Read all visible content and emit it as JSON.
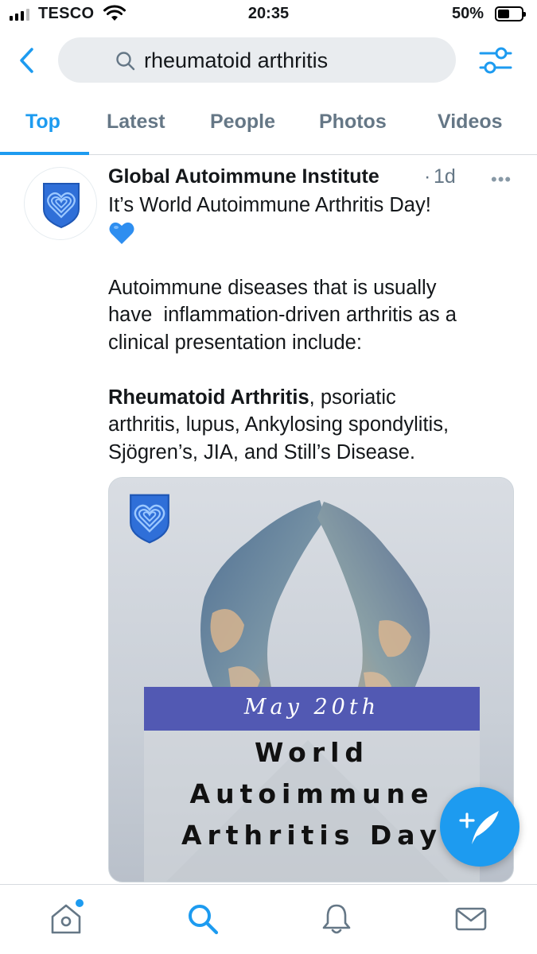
{
  "status_bar": {
    "carrier": "TESCO",
    "time": "20:35",
    "battery_percent": "50%",
    "battery_level": 0.5,
    "signal_bars": 3,
    "signal_bars_total": 4
  },
  "header": {
    "back_icon": "chevron-left-icon",
    "search_query": "rheumatoid arthritis",
    "search_icon": "search-icon",
    "filter_icon": "sliders-icon"
  },
  "tabs": [
    {
      "label": "Top",
      "active": true
    },
    {
      "label": "Latest",
      "active": false
    },
    {
      "label": "People",
      "active": false
    },
    {
      "label": "Photos",
      "active": false
    },
    {
      "label": "Videos",
      "active": false
    }
  ],
  "tweet": {
    "author": "Global Autoimmune Institute",
    "separator": "·",
    "age": "1d",
    "more_icon": "more-horizontal-icon",
    "line1": "It’s World Autoimmune Arthritis Day!",
    "emoji": "blue-heart-emoji",
    "para2": [
      "Autoimmune diseases that is usually",
      "have  inflammation-driven arthritis as a",
      "clinical presentation include:"
    ],
    "para3_bold": "Rheumatoid Arthritis",
    "para3_line1_rest": ", psoriatic",
    "para3_line2": "arthritis, lupus, Ankylosing spondylitis,",
    "para3_line3": "Sjögren’s, JIA, and Still’s Disease.",
    "media": {
      "date": "May 20th",
      "title_lines": [
        "World",
        "Autoimmune",
        "Arthritis Day"
      ]
    }
  },
  "fab": {
    "icon": "compose-tweet-icon"
  },
  "bottom_nav": [
    {
      "icon": "home-icon",
      "has_notification": true
    },
    {
      "icon": "search-icon",
      "active": true
    },
    {
      "icon": "bell-icon"
    },
    {
      "icon": "mail-icon"
    }
  ],
  "colors": {
    "accent": "#1d9bf0",
    "muted": "#657786",
    "search_bg": "#e9ecef",
    "media_band": "#5259b3"
  }
}
